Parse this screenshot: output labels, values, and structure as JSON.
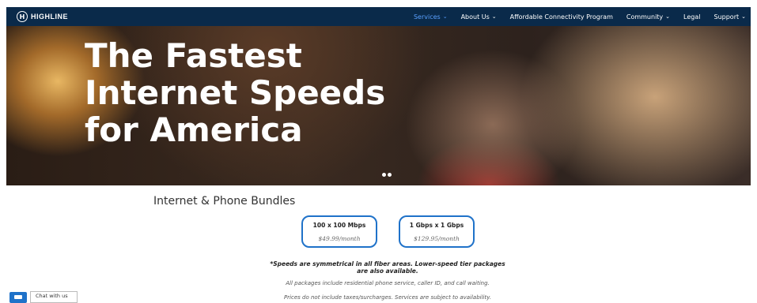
{
  "header": {
    "logo_text": "HIGHLINE",
    "menu": [
      {
        "label": "Services",
        "active": true,
        "has_caret": true
      },
      {
        "label": "About Us",
        "active": false,
        "has_caret": true
      },
      {
        "label": "Affordable Connectivity Program",
        "active": false,
        "has_caret": false
      },
      {
        "label": "Community",
        "active": false,
        "has_caret": true
      },
      {
        "label": "Legal",
        "active": false,
        "has_caret": false
      },
      {
        "label": "Support",
        "active": false,
        "has_caret": true
      }
    ]
  },
  "hero": {
    "line1": "The Fastest",
    "line2": "Internet Speeds",
    "line3": "for America",
    "slide_count": 2
  },
  "bundles": {
    "title": "Internet & Phone Bundles",
    "plans": [
      {
        "speed": "100 x 100 Mbps",
        "price": "$49.99/month"
      },
      {
        "speed": "1 Gbps x 1 Gbps",
        "price": "$129.95/month"
      }
    ],
    "note_bold_1": "*Speeds are symmetrical in all fiber areas. Lower-speed tier packages",
    "note_bold_2": "are also available.",
    "note_1": "All packages include residential phone service, caller ID, and call waiting.",
    "note_2": "Prices do not include taxes/surcharges. Services are subject to availability."
  },
  "chat": {
    "label": "Chat with us"
  },
  "colors": {
    "nav_bg": "#0a2a4a",
    "accent": "#1f72c9",
    "active_link": "#5aa0ff"
  },
  "icons": {
    "logo": "logo-h-circle-icon",
    "caret": "chevron-down-icon",
    "chat": "chat-bubble-icon"
  }
}
